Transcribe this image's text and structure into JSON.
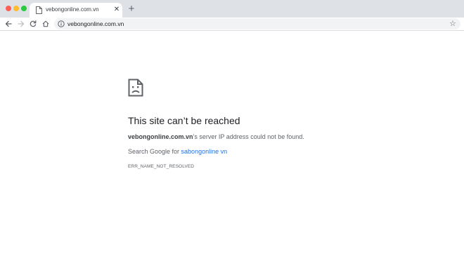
{
  "browser": {
    "tab": {
      "title": "vebongonline.com.vn",
      "favicon": "page-icon",
      "close_icon": "close-icon"
    },
    "new_tab_icon": "plus-icon",
    "toolbar": {
      "back_icon": "arrow-left-icon",
      "forward_icon": "arrow-right-icon",
      "reload_icon": "reload-icon",
      "home_icon": "home-icon",
      "url": "vebongonline.com.vn",
      "site_info_icon": "info-icon",
      "bookmark_icon": "star-icon"
    }
  },
  "error_page": {
    "icon": "sad-document-icon",
    "title": "This site can’t be reached",
    "host": "vebongonline.com.vn",
    "description_suffix": "’s server IP address could not be found.",
    "suggestion_prefix": "Search Google for ",
    "suggestion_link": "sabongonline vn",
    "error_code": "ERR_NAME_NOT_RESOLVED"
  },
  "colors": {
    "tabstrip_bg": "#dee1e6",
    "omnibox_bg": "#f1f3f4",
    "link": "#1a73e8",
    "title_text": "#202124",
    "secondary_text": "#5f6368"
  }
}
